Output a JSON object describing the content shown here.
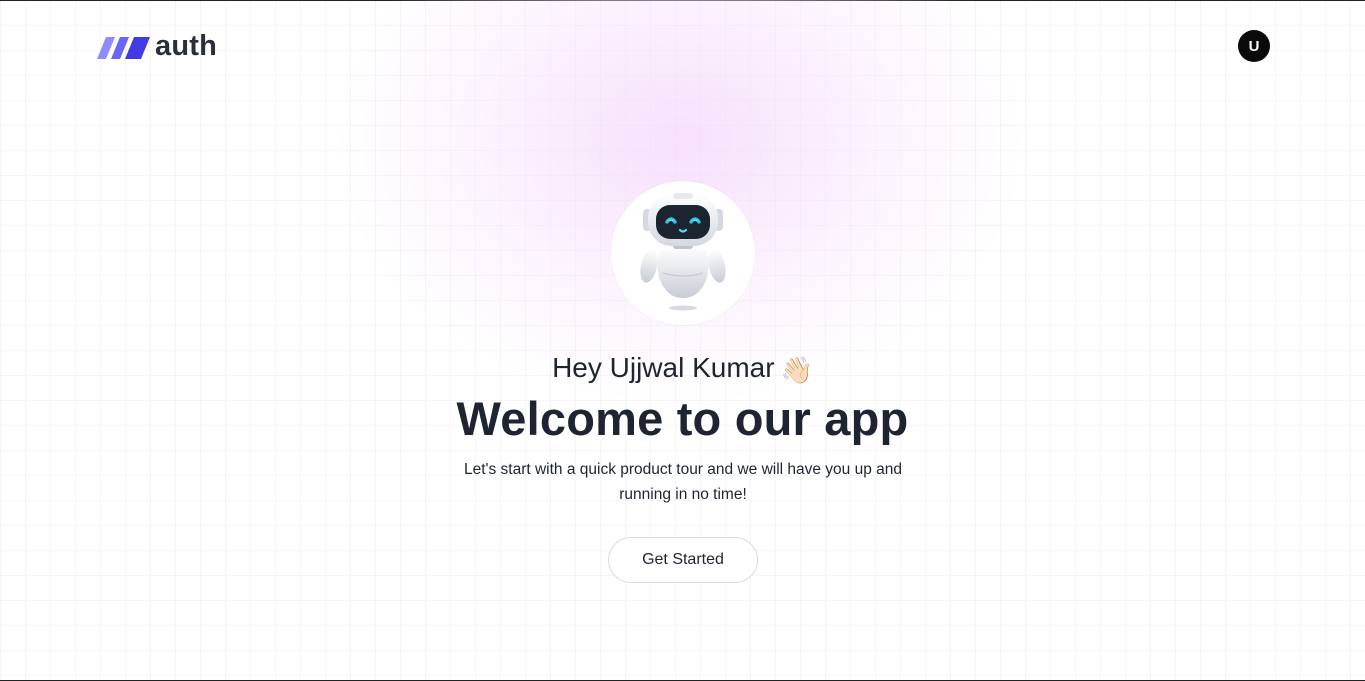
{
  "brand": {
    "name": "auth",
    "accent": "#6c5ce7",
    "mark_colors": [
      "#8f8cff",
      "#5b57f0",
      "#3d36e0"
    ]
  },
  "user": {
    "avatar_initial": "U"
  },
  "hero": {
    "greeting": "Hey Ujjwal Kumar",
    "greeting_emoji": "👋🏻",
    "title": "Welcome to our app",
    "subtitle": "Let's start with a quick product tour and we will have you up and running in no time!",
    "cta_label": "Get Started",
    "illustration": "robot-icon"
  },
  "colors": {
    "text": "#1e2432",
    "avatar_bg": "#0a0a0a",
    "glow": "#f4d6fa"
  }
}
